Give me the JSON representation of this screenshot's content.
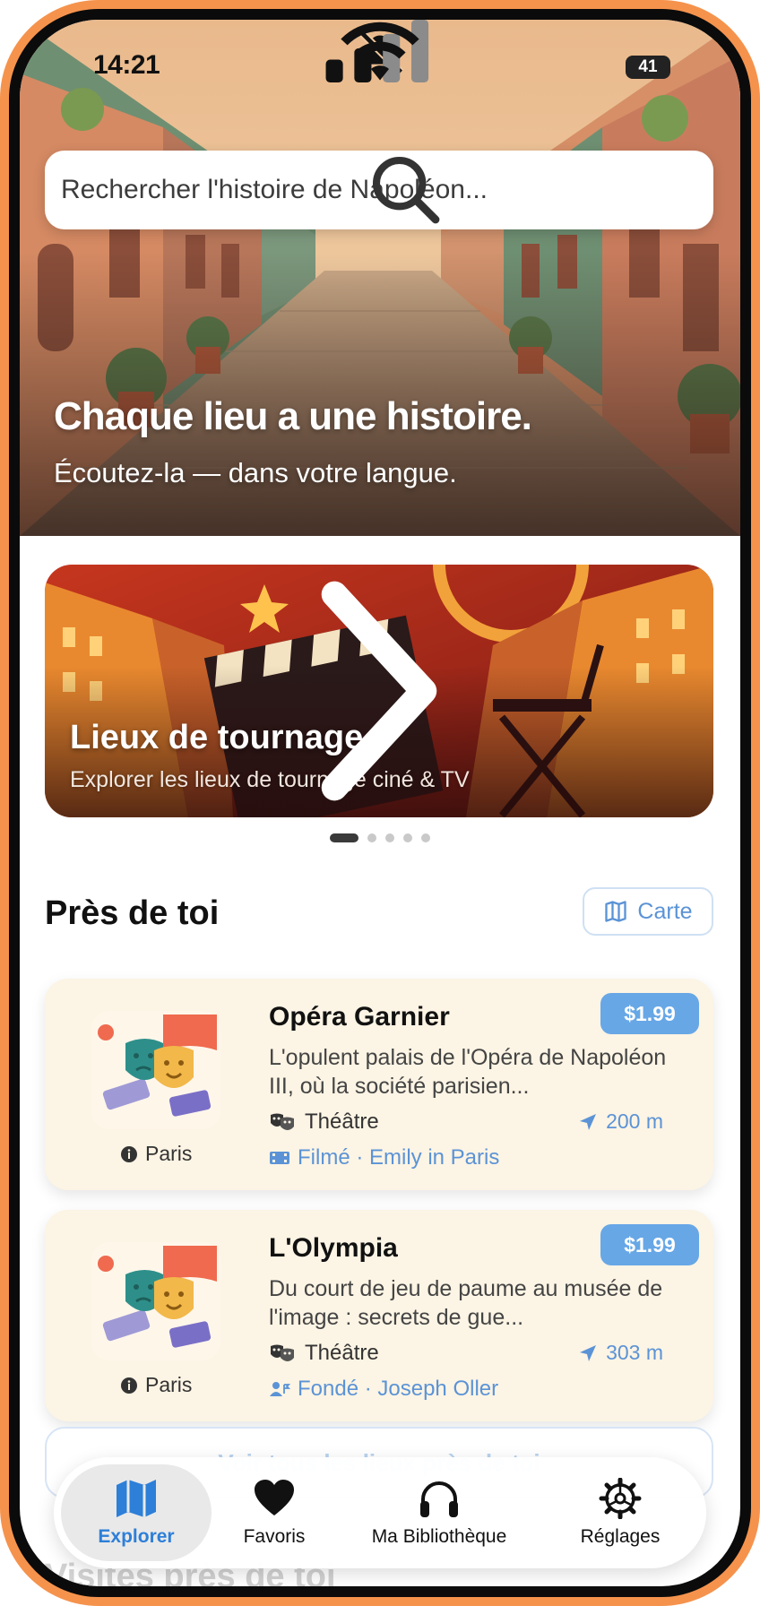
{
  "status_bar": {
    "time": "14:21",
    "battery": "41"
  },
  "search": {
    "placeholder": "Rechercher l'histoire de Napoléon..."
  },
  "hero": {
    "title": "Chaque lieu a une histoire.",
    "subtitle": "Écoutez-la — dans votre langue."
  },
  "banner": {
    "title": "Lieux de tournage",
    "subtitle": "Explorer les lieux de tournage ciné & TV",
    "page_count": 5,
    "active_page": 1
  },
  "near_you": {
    "title": "Près de toi",
    "map_button": "Carte",
    "places": [
      {
        "name": "Opéra Garnier",
        "price": "$1.99",
        "description": "L'opulent palais de l'Opéra de Napoléon III, où la société parisien...",
        "category": "Théâtre",
        "distance": "200 m",
        "tag": "Filmé · Emily in Paris",
        "city": "Paris"
      },
      {
        "name": "L'Olympia",
        "price": "$1.99",
        "description": "Du court de jeu de paume au musée de l'image : secrets de gue...",
        "category": "Théâtre",
        "distance": "303 m",
        "tag": "Fondé · Joseph Oller",
        "city": "Paris"
      }
    ],
    "more_button": "Voir tous les lieux près de toi"
  },
  "next_section": {
    "title": "Visites près de toi"
  },
  "tabs": [
    {
      "label": "Explorer",
      "icon": "map-icon",
      "active": true
    },
    {
      "label": "Favoris",
      "icon": "heart-icon",
      "active": false
    },
    {
      "label": "Ma Bibliothèque",
      "icon": "headphones-icon",
      "active": false
    },
    {
      "label": "Réglages",
      "icon": "gear-icon",
      "active": false
    }
  ],
  "colors": {
    "accent": "#2d7fd8",
    "price_badge": "#67a7e6",
    "card_bg": "#fcf4e4",
    "frame": "#f5934d"
  }
}
